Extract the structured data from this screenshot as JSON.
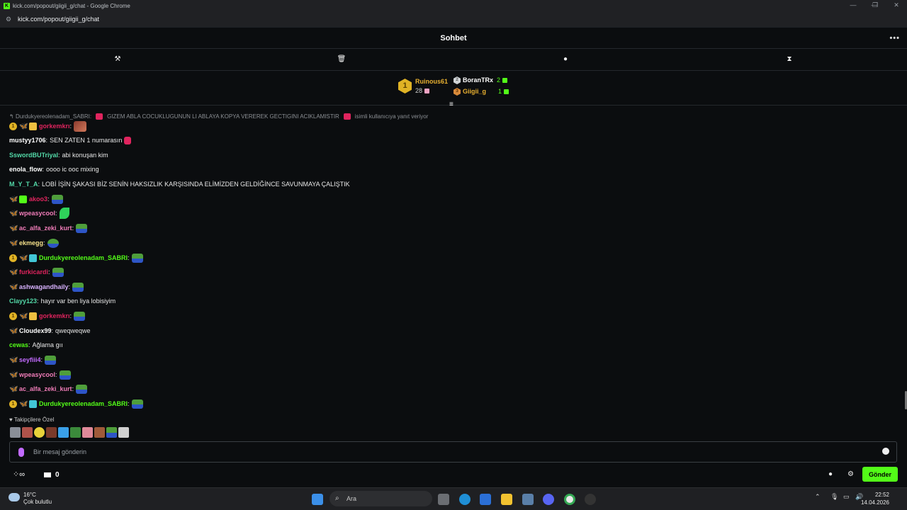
{
  "window": {
    "title": "kick.com/popout/giigii_g/chat - Google Chrome",
    "url": "kick.com/popout/giigii_g/chat"
  },
  "header": {
    "title": "Sohbet",
    "more": "•••"
  },
  "leaderboard": {
    "first": {
      "rank": "1",
      "name": "Ruinous61",
      "count": "28"
    },
    "second": {
      "name": "BoranTRx",
      "count": "2"
    },
    "third": {
      "name": "Giigii_g",
      "count": "1"
    }
  },
  "reply": {
    "user": "Durdukyereolenadam_SABRI:",
    "text": "GIZEM ABLA COCUKLUGUNUN LI ABLAYA KOPYA VEREREK GECTIGINI ACIKLAMISTIR",
    "suffix": "isimli kullanıcıya yanıt veriyor"
  },
  "messages": [
    {
      "user": "gorkemkrı",
      "color": "#e0245e",
      "text": ""
    },
    {
      "user": "mustyy1706",
      "color": "#ffffff",
      "text": "SEN ZATEN 1 numarasın"
    },
    {
      "user": "SswordBUTriyal",
      "color": "#53d9a8",
      "text": "abi konuşan kim"
    },
    {
      "user": "enola_flow",
      "color": "#ffffff",
      "text": "oooo ic ooc mixing"
    },
    {
      "user": "M_Y_T_A",
      "color": "#53d9a8",
      "text": "LOBİ İŞİN ŞAKASI BİZ SENİN HAKSIZLIK KARŞISINDA ELİMİZDEN GELDİĞİNCE SAVUNMAYA ÇALIŞTIK"
    },
    {
      "user": "akoo3",
      "color": "#e0245e",
      "text": ""
    },
    {
      "user": "wpeasycool",
      "color": "#f07cb8",
      "text": ""
    },
    {
      "user": "ac_alfa_zeki_kurt",
      "color": "#f07cb8",
      "text": ""
    },
    {
      "user": "ekmegg",
      "color": "#f5e08a",
      "text": ""
    },
    {
      "user": "Durdukyereolenadam_SABRI",
      "color": "#53fc18",
      "text": ""
    },
    {
      "user": "furkicardi",
      "color": "#e0245e",
      "text": ""
    },
    {
      "user": "ashwagandhaily",
      "color": "#d9b3ff",
      "text": ""
    },
    {
      "user": "Clayy123",
      "color": "#53d9a8",
      "text": "hayır var ben liya lobisiyim"
    },
    {
      "user": "gorkemkrı",
      "color": "#e0245e",
      "text": ""
    },
    {
      "user": "Cloudex99",
      "color": "#ffffff",
      "text": "qweqweqwe"
    },
    {
      "user": "cewas",
      "color": "#53fc18",
      "text": "Ağlama gıı"
    },
    {
      "user": "seyfiii4",
      "color": "#c26bff",
      "text": ""
    },
    {
      "user": "wpeasycool",
      "color": "#f07cb8",
      "text": ""
    },
    {
      "user": "ac_alfa_zeki_kurt",
      "color": "#f07cb8",
      "text": ""
    },
    {
      "user": "Durdukyereolenadam_SABRI",
      "color": "#53fc18",
      "text": ""
    }
  ],
  "followers": {
    "label": "Takipçilere Özel"
  },
  "input": {
    "placeholder": "Bir mesaj gönderin"
  },
  "bottom": {
    "points": "0",
    "send_label": "Gönder"
  },
  "taskbar": {
    "temp": "16°C",
    "weather": "Çok bulutlu",
    "search": "Ara",
    "time": "22:52",
    "date": "14.04.2026"
  }
}
